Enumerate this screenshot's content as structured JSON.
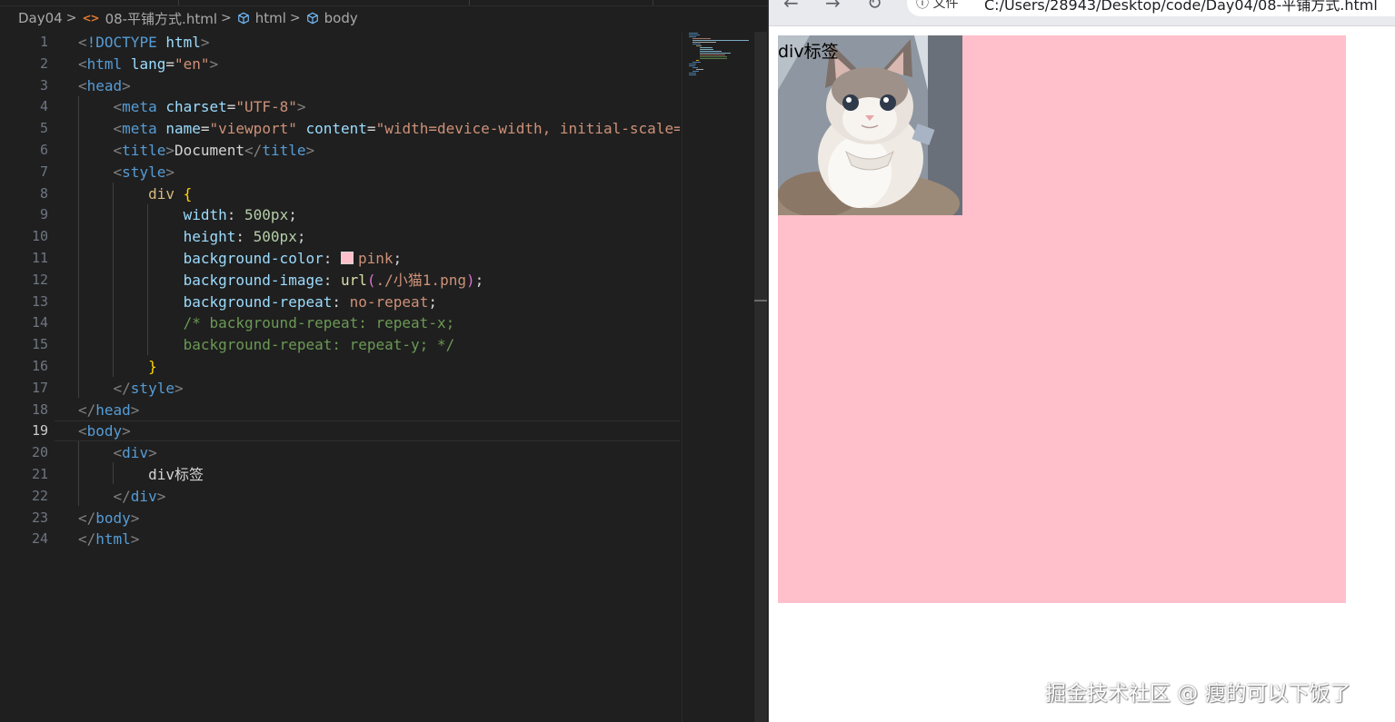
{
  "breadcrumb": {
    "folder": "Day04",
    "file": "08-平铺方式.html",
    "node1": "html",
    "node2": "body"
  },
  "editor": {
    "line_numbers": [
      "1",
      "2",
      "3",
      "4",
      "5",
      "6",
      "7",
      "8",
      "9",
      "10",
      "11",
      "12",
      "13",
      "14",
      "15",
      "16",
      "17",
      "18",
      "19",
      "20",
      "21",
      "22",
      "23",
      "24"
    ],
    "active_line": "19",
    "code": {
      "doctype_kw": "!DOCTYPE",
      "doctype_val": "html",
      "lang_val": "\"en\"",
      "charset_val": "\"UTF-8\"",
      "viewport_val": "\"viewport\"",
      "content_val": "\"width=device-width, initial-scale=",
      "title_text": "Document",
      "selector": "div",
      "width_val": "500px",
      "height_val": "500px",
      "bgcolor_val": "pink",
      "bgimage_path": "./小猫1.png",
      "repeat_val": "no-repeat",
      "comment_1": "/* background-repeat: repeat-x;",
      "comment_2": "background-repeat: repeat-y; */",
      "div_text": "div标签"
    },
    "swatch_color": "#ffc0cb"
  },
  "browser": {
    "info_label": "文件",
    "url": "C:/Users/28943/Desktop/code/Day04/08-平铺方式.html",
    "page": {
      "div_text": "div标签",
      "div_bg_color": "#ffc0cb"
    }
  },
  "watermark": "掘金技术社区 @ 瘦的可以下饭了"
}
